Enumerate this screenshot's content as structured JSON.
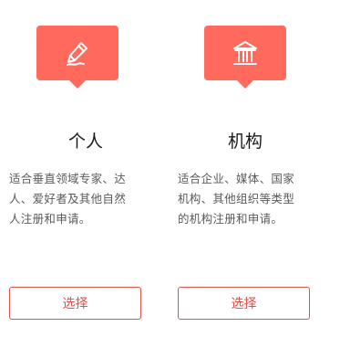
{
  "cards": [
    {
      "icon": "pen-icon",
      "title": "个人",
      "desc_lines": [
        "适合垂直领域专家、达",
        "人、爱好者及其他自然",
        "人注册和申请。"
      ],
      "button_label": "选择"
    },
    {
      "icon": "institution-icon",
      "title": "机构",
      "desc_lines": [
        "适合企业、媒体、国家",
        "机构、其他组织等类型",
        "的机构注册和申请。"
      ],
      "button_label": "选择"
    }
  ],
  "colors": {
    "accent": "#ff6a5c",
    "button_border": "#e2504a"
  }
}
